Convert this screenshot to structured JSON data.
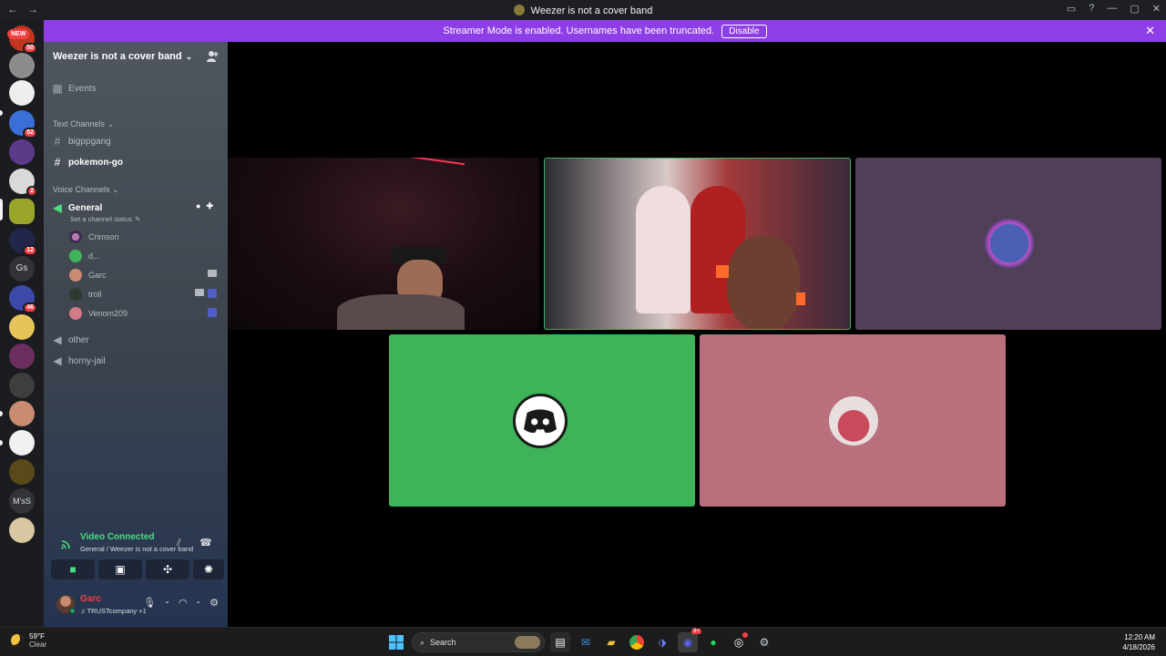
{
  "window": {
    "title": "Weezer is not a cover band",
    "back": "←",
    "forward": "→",
    "controls": [
      "▭",
      "?",
      "—",
      "▢",
      "✕"
    ]
  },
  "banner": {
    "text": "Streamer Mode is enabled. Usernames have been truncated.",
    "button": "Disable",
    "close": "✕"
  },
  "guilds": {
    "new_tag": "NEW",
    "badges": [
      "50",
      "52",
      "2",
      "12",
      "46"
    ],
    "text_guilds": [
      "Gs",
      "M'sS"
    ]
  },
  "server": {
    "name": "Weezer is not a cover band",
    "events_label": "Events",
    "text_category": "Text Channels",
    "text_channels": [
      "bigppgang",
      "pokemon-go"
    ],
    "voice_category": "Voice Channels",
    "voice_channels": {
      "general": "General",
      "general_status": "Set a channel status",
      "other": "other",
      "horny_jail": "horny-jail"
    },
    "voice_users": [
      "Crimson",
      "d...",
      "Garc",
      "troll",
      "Venom209"
    ]
  },
  "voice_panel": {
    "status": "Video Connected",
    "location": "General / Weezer is not a cover band"
  },
  "user_panel": {
    "username": "Garc",
    "status": "TRUSTcompany +1"
  },
  "colors": {
    "banner": "#8e3ee6",
    "tile_purple": "#4f3f57",
    "tile_green": "#3fb35a",
    "tile_pink": "#b9707c",
    "connected_green": "#4ade80",
    "username_red": "#f23f43"
  },
  "taskbar": {
    "temp": "59°F",
    "condition": "Clear",
    "search": "Search",
    "time": "12:20 AM",
    "date": "4/18/2026",
    "discord_badge": "9+"
  }
}
